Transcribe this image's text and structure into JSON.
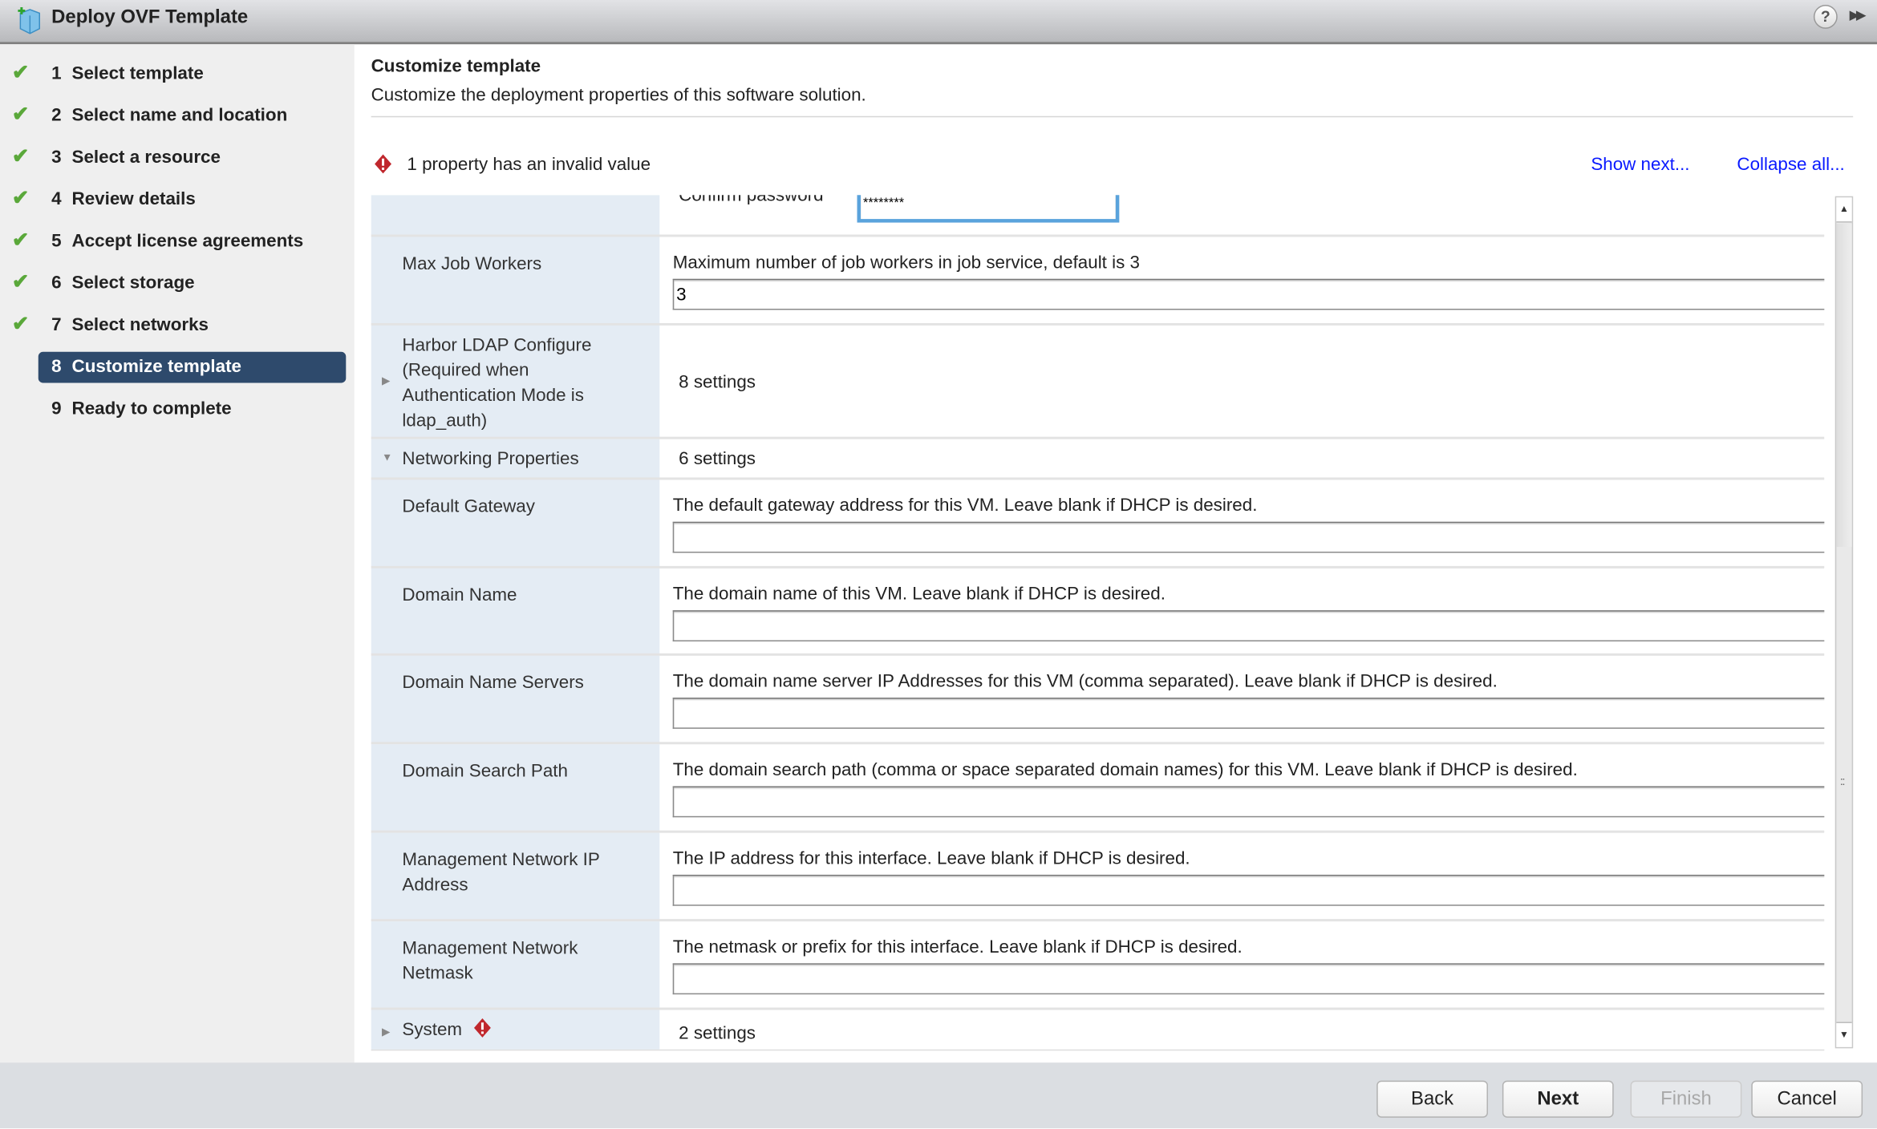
{
  "window": {
    "title": "Deploy OVF Template",
    "help_label": "?",
    "expand_label": "▶▶"
  },
  "steps": [
    {
      "num": "1",
      "label": "Select template",
      "done": true
    },
    {
      "num": "2",
      "label": "Select name and location",
      "done": true
    },
    {
      "num": "3",
      "label": "Select a resource",
      "done": true
    },
    {
      "num": "4",
      "label": "Review details",
      "done": true
    },
    {
      "num": "5",
      "label": "Accept license agreements",
      "done": true
    },
    {
      "num": "6",
      "label": "Select storage",
      "done": true
    },
    {
      "num": "7",
      "label": "Select networks",
      "done": true
    },
    {
      "num": "8",
      "label": "Customize template",
      "done": false,
      "active": true
    },
    {
      "num": "9",
      "label": "Ready to complete",
      "done": false
    }
  ],
  "main": {
    "title": "Customize template",
    "subtitle": "Customize the deployment properties of this software solution.",
    "warning": "1 property has an invalid value",
    "show_next": "Show next...",
    "collapse_all": "Collapse all..."
  },
  "rows": [
    {
      "type": "partial",
      "sublabel": "Confirm password",
      "value": "********"
    },
    {
      "type": "field",
      "label": "Max Job Workers",
      "desc": "Maximum number of job workers in job service, default is 3",
      "value": "3"
    },
    {
      "type": "group",
      "label": "Harbor LDAP Configure (Required when Authentication Mode is ldap_auth)",
      "count": "8 settings",
      "expanded": false
    },
    {
      "type": "group",
      "label": "Networking Properties",
      "count": "6 settings",
      "expanded": true
    },
    {
      "type": "field",
      "label": "Default Gateway",
      "desc": "The default gateway address for this VM. Leave blank if DHCP is desired.",
      "value": ""
    },
    {
      "type": "field",
      "label": "Domain Name",
      "desc": "The domain name of this VM. Leave blank if DHCP is desired.",
      "value": ""
    },
    {
      "type": "field",
      "label": "Domain Name Servers",
      "desc": "The domain name server IP Addresses for this VM (comma separated). Leave blank if DHCP is desired.",
      "value": ""
    },
    {
      "type": "field",
      "label": "Domain Search Path",
      "desc": "The domain search path (comma or space separated domain names) for this VM. Leave blank if DHCP is desired.",
      "value": ""
    },
    {
      "type": "field",
      "label": "Management Network IP Address",
      "desc": "The IP address for this interface. Leave blank if DHCP is desired.",
      "value": ""
    },
    {
      "type": "field",
      "label": "Management Network Netmask",
      "desc": "The netmask or prefix for this interface. Leave blank if DHCP is desired.",
      "value": ""
    },
    {
      "type": "group",
      "label": "System",
      "count": "2 settings",
      "expanded": false,
      "error": true
    }
  ],
  "footer": {
    "back": "Back",
    "next": "Next",
    "finish": "Finish",
    "cancel": "Cancel"
  },
  "colors": {
    "accent": "#2e4a6c",
    "link": "#0a1aff",
    "error": "#c0272d",
    "check": "#5aa83a"
  }
}
